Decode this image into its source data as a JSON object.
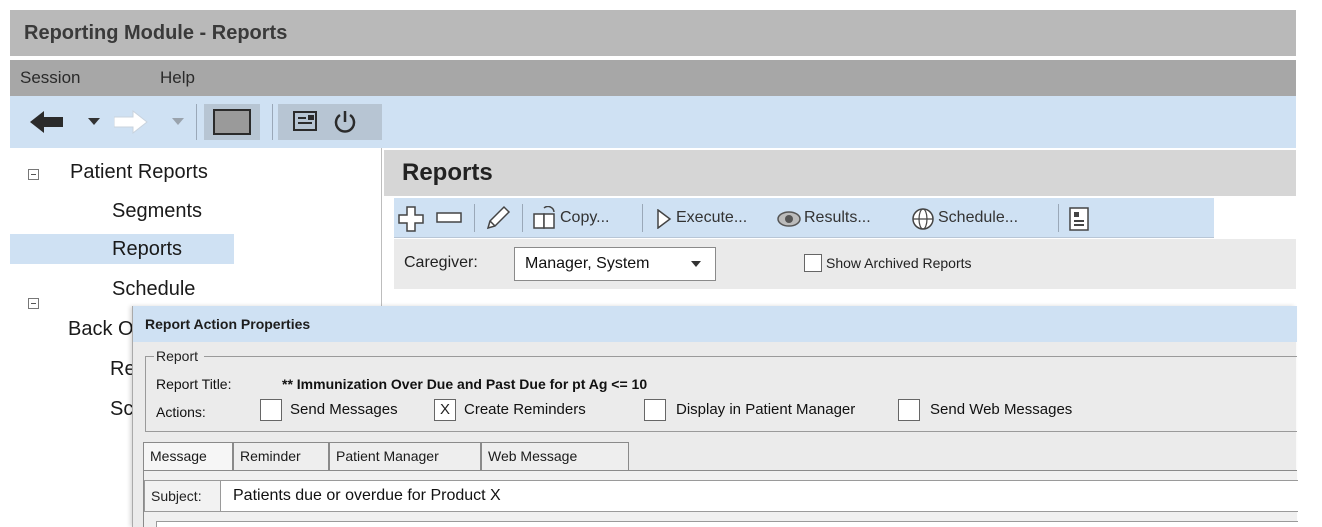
{
  "window": {
    "title": "Reporting Module - Reports"
  },
  "menu": {
    "items": [
      "Session",
      "Help"
    ]
  },
  "toolbar": {
    "icons": [
      "back-arrow-icon",
      "dropdown-icon",
      "forward-arrow-icon",
      "dropdown-icon",
      "stop-icon",
      "printer-icon",
      "power-icon"
    ]
  },
  "tree": {
    "groups": [
      {
        "label": "Patient Reports",
        "children": [
          "Segments",
          "Reports",
          "Schedule"
        ]
      },
      {
        "label": "Back Office",
        "children": [
          "Reports",
          "Schedule"
        ]
      }
    ],
    "selected": "Reports"
  },
  "reports": {
    "title": "Reports",
    "toolbar": {
      "copy": "Copy...",
      "execute": "Execute...",
      "results": "Results...",
      "schedule": "Schedule..."
    },
    "filter": {
      "caregiver_label": "Caregiver:",
      "caregiver_value": "Manager, System",
      "show_archived_label": "Show Archived Reports",
      "show_archived_checked": false
    }
  },
  "dialog": {
    "title": "Report Action Properties",
    "group_label": "Report",
    "report_title_label": "Report Title:",
    "report_title_value": "** Immunization Over Due and Past Due for pt Ag <= 10",
    "actions_label": "Actions:",
    "actions": [
      {
        "label": "Send Messages",
        "checked": false
      },
      {
        "label": "Create Reminders",
        "checked": true
      },
      {
        "label": "Display in Patient Manager",
        "checked": false
      },
      {
        "label": "Send Web Messages",
        "checked": false
      }
    ],
    "check_mark": "X",
    "tabs": [
      "Message",
      "Reminder",
      "Patient Manager",
      "Web Message"
    ],
    "active_tab": "Message",
    "subject_label": "Subject:",
    "subject_value": "Patients due or overdue for Product X"
  }
}
